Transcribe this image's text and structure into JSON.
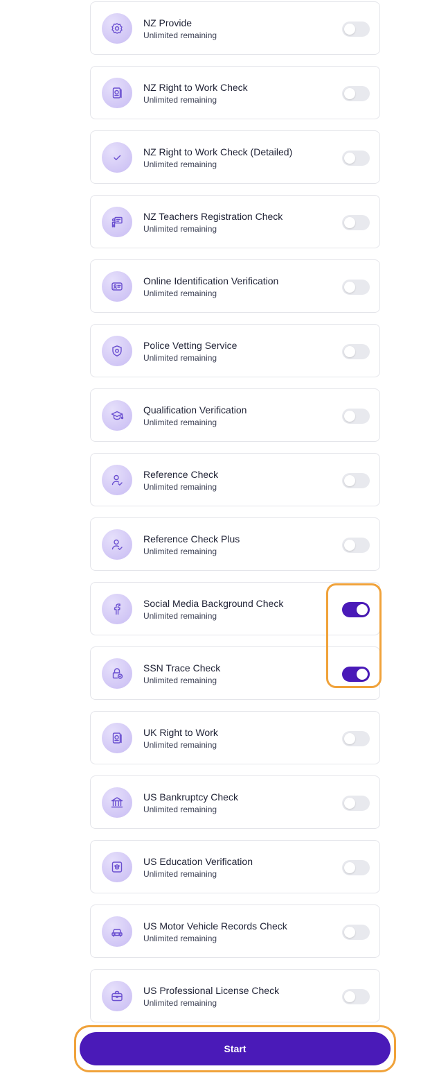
{
  "checks": [
    {
      "title": "NZ Provide",
      "subtitle": "Unlimited remaining",
      "icon": "badge-icon",
      "enabled": false
    },
    {
      "title": "NZ Right to Work Check",
      "subtitle": "Unlimited remaining",
      "icon": "passport-icon",
      "enabled": false
    },
    {
      "title": "NZ Right to Work Check (Detailed)",
      "subtitle": "Unlimited remaining",
      "icon": "check-icon",
      "enabled": false
    },
    {
      "title": "NZ Teachers Registration Check",
      "subtitle": "Unlimited remaining",
      "icon": "teacher-board-icon",
      "enabled": false
    },
    {
      "title": "Online Identification Verification",
      "subtitle": "Unlimited remaining",
      "icon": "id-card-icon",
      "enabled": false
    },
    {
      "title": "Police Vetting Service",
      "subtitle": "Unlimited remaining",
      "icon": "police-badge-icon",
      "enabled": false
    },
    {
      "title": "Qualification Verification",
      "subtitle": "Unlimited remaining",
      "icon": "graduation-cap-icon",
      "enabled": false
    },
    {
      "title": "Reference Check",
      "subtitle": "Unlimited remaining",
      "icon": "user-check-icon",
      "enabled": false
    },
    {
      "title": "Reference Check Plus",
      "subtitle": "Unlimited remaining",
      "icon": "user-check-icon",
      "enabled": false
    },
    {
      "title": "Social Media Background Check",
      "subtitle": "Unlimited remaining",
      "icon": "facebook-icon",
      "enabled": true
    },
    {
      "title": "SSN Trace Check",
      "subtitle": "Unlimited remaining",
      "icon": "lock-check-icon",
      "enabled": true
    },
    {
      "title": "UK Right to Work",
      "subtitle": "Unlimited remaining",
      "icon": "passport-icon",
      "enabled": false
    },
    {
      "title": "US Bankruptcy Check",
      "subtitle": "Unlimited remaining",
      "icon": "bank-icon",
      "enabled": false
    },
    {
      "title": "US Education Verification",
      "subtitle": "Unlimited remaining",
      "icon": "education-doc-icon",
      "enabled": false
    },
    {
      "title": "US Motor Vehicle Records Check",
      "subtitle": "Unlimited remaining",
      "icon": "car-icon",
      "enabled": false
    },
    {
      "title": "US Professional License Check",
      "subtitle": "Unlimited remaining",
      "icon": "briefcase-icon",
      "enabled": false
    }
  ],
  "start_label": "Start",
  "colors": {
    "accent": "#4a1ab8",
    "highlight": "#f0a23a",
    "toggle_off": "#e8e9ee",
    "icon_stroke": "#6a4fd0"
  }
}
